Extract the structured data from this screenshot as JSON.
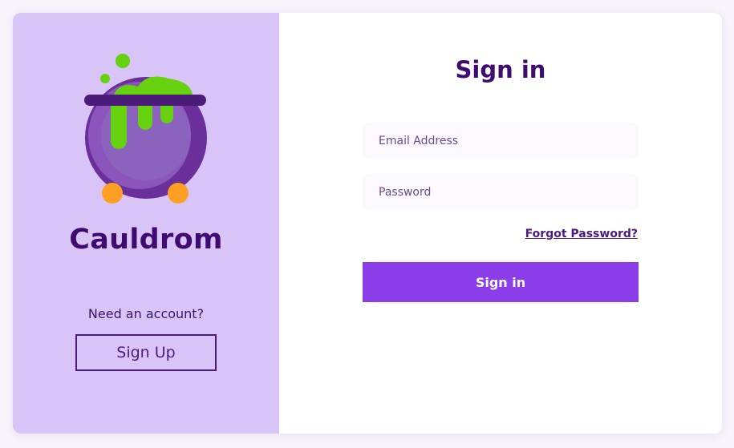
{
  "brand": {
    "name": "Cauldrom",
    "logo_icon": "cauldron-icon"
  },
  "left_panel": {
    "prompt": "Need an account?",
    "signup_label": "Sign Up"
  },
  "form": {
    "title": "Sign in",
    "email_placeholder": "Email Address",
    "password_placeholder": "Password",
    "forgot_label": "Forgot Password?",
    "submit_label": "Sign in"
  },
  "colors": {
    "accent": "#8a3de8",
    "panel": "#d9c4f8",
    "heading": "#3f0b6f",
    "slime": "#66d10f",
    "cauldron": "#6a2f9a",
    "legs": "#ff9f24"
  }
}
